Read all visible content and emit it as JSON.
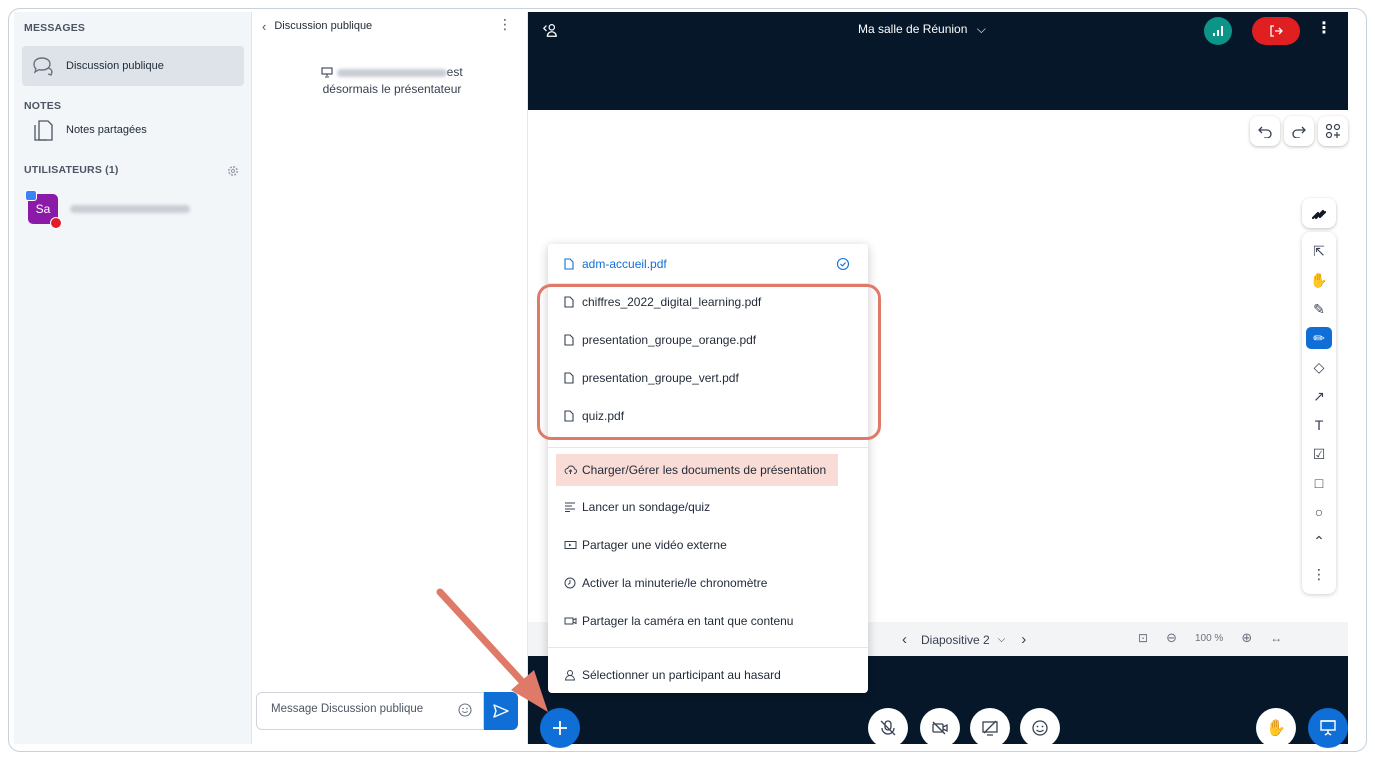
{
  "sidebar": {
    "messages_title": "MESSAGES",
    "public_chat": "Discussion publique",
    "notes_title": "NOTES",
    "shared_notes": "Notes partagées",
    "users_title": "UTILISATEURS (1)",
    "user_initials": "Sa"
  },
  "chat": {
    "title": "Discussion publique",
    "system_suffix": "est",
    "system_line2": "désormais le présentateur",
    "input_placeholder": "Message Discussion publique"
  },
  "topbar": {
    "room_title": "Ma salle de Réunion"
  },
  "slide_nav": {
    "label": "Diapositive 2",
    "zoom": "100 %"
  },
  "dropdown": {
    "current_file": "adm-accueil.pdf",
    "files": [
      "chiffres_2022_digital_learning.pdf",
      "presentation_groupe_orange.pdf",
      "presentation_groupe_vert.pdf",
      "quiz.pdf"
    ],
    "actions": [
      "Charger/Gérer les documents de présentation",
      "Lancer un sondage/quiz",
      "Partager une vidéo externe",
      "Activer la minuterie/le chronomètre",
      "Partager la caméra en tant que contenu",
      "Sélectionner un participant au hasard"
    ]
  },
  "colors": {
    "accent": "#0f6fd6",
    "dark_bar": "#06172a",
    "leave": "#e02020",
    "highlight": "#e07a68"
  }
}
